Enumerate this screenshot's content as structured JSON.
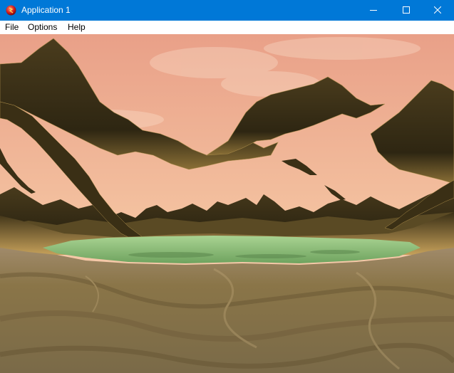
{
  "window": {
    "title": "Application 1",
    "icon": "red-sphere-icon",
    "controls": [
      "minimize-icon",
      "maximize-icon",
      "close-icon"
    ]
  },
  "menu": {
    "items": [
      {
        "label": "File"
      },
      {
        "label": "Options"
      },
      {
        "label": "Help"
      }
    ]
  },
  "scene": {
    "sky_top": "#e9a088",
    "sky_bottom": "#f7d9bd",
    "mountain_color": "#3d3217",
    "mountain_highlight": "#a88a48",
    "water_color": "#8fc27d",
    "ground_color": "#8d7a52"
  }
}
